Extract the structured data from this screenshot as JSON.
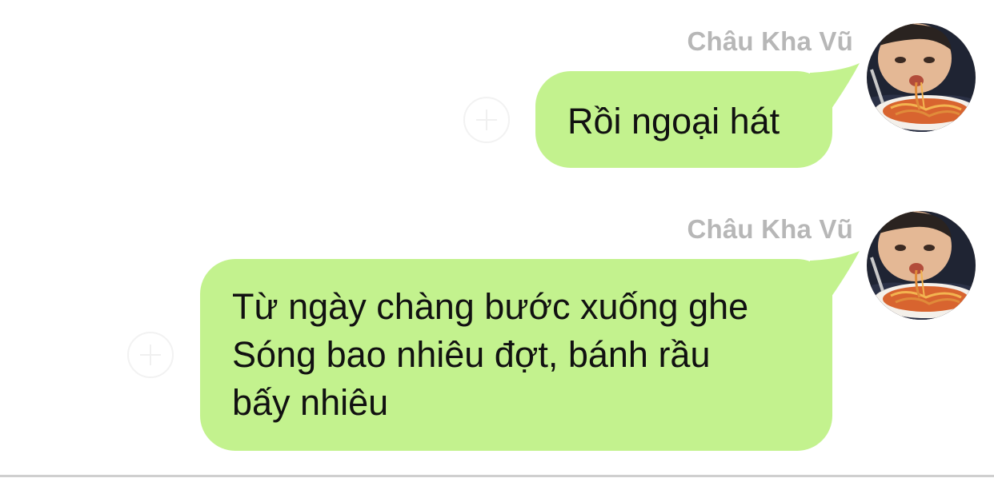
{
  "colors": {
    "bubble": "#c3f28e",
    "sender_name": "#b7b7b7",
    "message_text": "#111111"
  },
  "messages": [
    {
      "sender": "Châu Kha Vũ",
      "lines": [
        "Rồi ngoại hát"
      ],
      "avatar_icon": "user-photo-avatar",
      "reaction_icon": "add-reaction-icon"
    },
    {
      "sender": "Châu Kha Vũ",
      "lines": [
        "Từ ngày chàng bước xuống ghe",
        "Sóng bao nhiêu đợt, bánh rầu",
        "bấy nhiêu"
      ],
      "avatar_icon": "user-photo-avatar",
      "reaction_icon": "add-reaction-icon"
    }
  ]
}
